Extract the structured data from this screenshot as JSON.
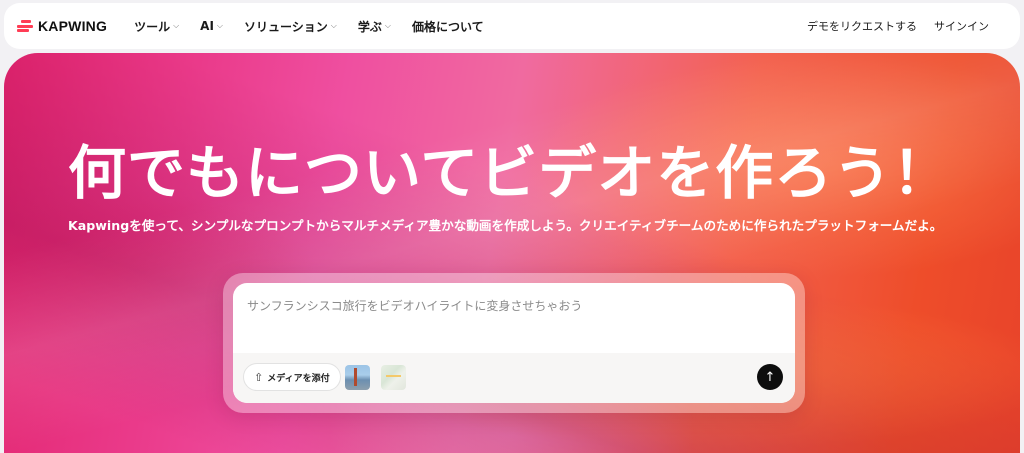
{
  "header": {
    "logo_text": "KAPWING",
    "brand_color": "#ff3d55",
    "nav": [
      {
        "label": "ツール",
        "has_dropdown": true
      },
      {
        "label": "AI",
        "has_dropdown": true
      },
      {
        "label": "ソリューション",
        "has_dropdown": true
      },
      {
        "label": "学ぶ",
        "has_dropdown": true
      },
      {
        "label": "価格について",
        "has_dropdown": false
      }
    ],
    "demo_label": "デモをリクエストする",
    "signin_label": "サインイン"
  },
  "hero": {
    "headline": "何でもについてビデオを作ろう！",
    "subline": "Kapwingを使って、シンプルなプロンプトからマルチメディア豊かな動画を作成しよう。クリエイティブチームのために作られたプラットフォームだよ。",
    "prompt": {
      "placeholder": "サンフランシスコ旅行をビデオハイライトに変身させちゃおう",
      "value": "",
      "attach_label": "メディアを添付"
    }
  },
  "icons": {
    "chevron": "chevron-down-icon",
    "upload": "upload-icon",
    "send": "arrow-up-icon"
  }
}
